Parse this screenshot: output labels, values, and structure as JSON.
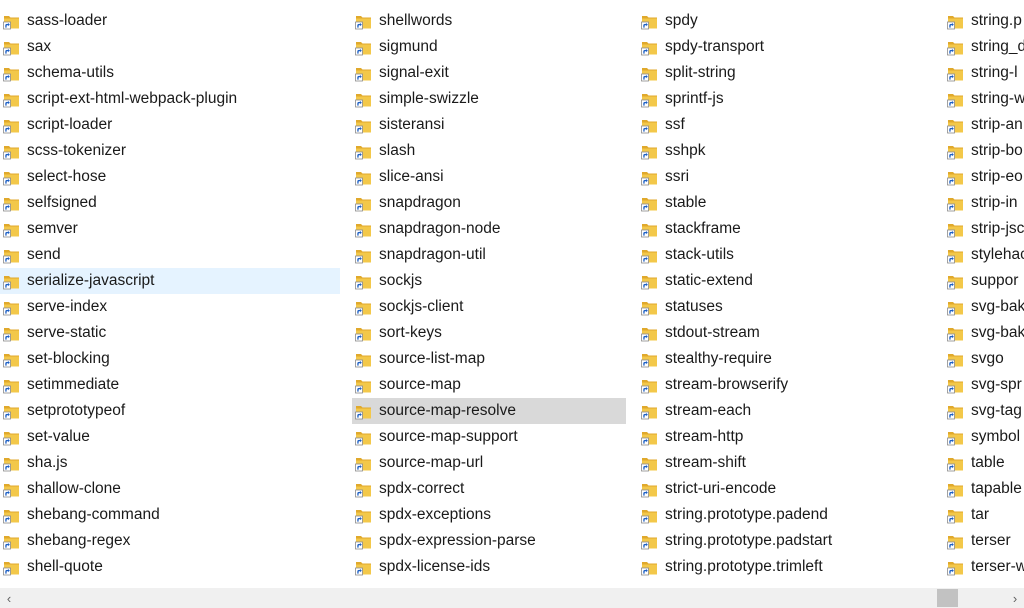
{
  "columns": [
    {
      "items": [
        "sass-loader",
        "sax",
        "schema-utils",
        "script-ext-html-webpack-plugin",
        "script-loader",
        "scss-tokenizer",
        "select-hose",
        "selfsigned",
        "semver",
        "send",
        "serialize-javascript",
        "serve-index",
        "serve-static",
        "set-blocking",
        "setimmediate",
        "setprototypeof",
        "set-value",
        "sha.js",
        "shallow-clone",
        "shebang-command",
        "shebang-regex",
        "shell-quote"
      ]
    },
    {
      "items": [
        "shellwords",
        "sigmund",
        "signal-exit",
        "simple-swizzle",
        "sisteransi",
        "slash",
        "slice-ansi",
        "snapdragon",
        "snapdragon-node",
        "snapdragon-util",
        "sockjs",
        "sockjs-client",
        "sort-keys",
        "source-list-map",
        "source-map",
        "source-map-resolve",
        "source-map-support",
        "source-map-url",
        "spdx-correct",
        "spdx-exceptions",
        "spdx-expression-parse",
        "spdx-license-ids"
      ]
    },
    {
      "items": [
        "spdy",
        "spdy-transport",
        "split-string",
        "sprintf-js",
        "ssf",
        "sshpk",
        "ssri",
        "stable",
        "stackframe",
        "stack-utils",
        "static-extend",
        "statuses",
        "stdout-stream",
        "stealthy-require",
        "stream-browserify",
        "stream-each",
        "stream-http",
        "stream-shift",
        "strict-uri-encode",
        "string.prototype.padend",
        "string.prototype.padstart",
        "string.prototype.trimleft"
      ]
    },
    {
      "items": [
        "string.p",
        "string_d",
        "string-l",
        "string-w",
        "strip-an",
        "strip-bo",
        "strip-eo",
        "strip-in",
        "strip-jsc",
        "stylehac",
        "suppor",
        "svg-bak",
        "svg-bak",
        "svgo",
        "svg-spr",
        "svg-tag",
        "symbol",
        "table",
        "tapable",
        "tar",
        "terser",
        "terser-w"
      ]
    }
  ],
  "hover_item": {
    "column": 0,
    "index": 10
  },
  "selected_item": {
    "column": 1,
    "index": 15
  },
  "icon": "folder-shortcut-icon",
  "scrollbar": {
    "left_arrow": "‹",
    "right_arrow": "›",
    "position": 0.95
  },
  "colors": {
    "hover_bg": "#e5f3ff",
    "selected_bg": "#d9d9d9",
    "folder": "#f3c84a",
    "shortcut_arrow": "#1c5fc4"
  }
}
